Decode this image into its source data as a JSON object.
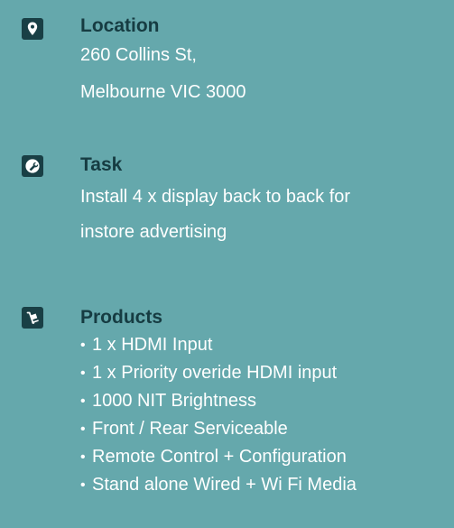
{
  "location": {
    "heading": "Location",
    "lines": [
      "260 Collins St,",
      "Melbourne VIC 3000"
    ]
  },
  "task": {
    "heading": "Task",
    "lines": [
      "Install 4 x display back to back for",
      "instore advertising"
    ]
  },
  "products": {
    "heading": "Products",
    "items": [
      "1 x HDMI Input",
      "1 x Priority overide HDMI input",
      "1000 NIT Brightness",
      "Front / Rear Serviceable",
      "Remote Control + Configuration",
      "Stand alone Wired + Wi Fi Media"
    ]
  },
  "icons": {
    "location": "map-pin-icon",
    "task": "wrench-icon",
    "products": "hand-truck-icon"
  },
  "colors": {
    "background": "#65a8ac",
    "heading": "#163c42",
    "icon_background": "#193f45",
    "body_text": "#ffffff"
  }
}
